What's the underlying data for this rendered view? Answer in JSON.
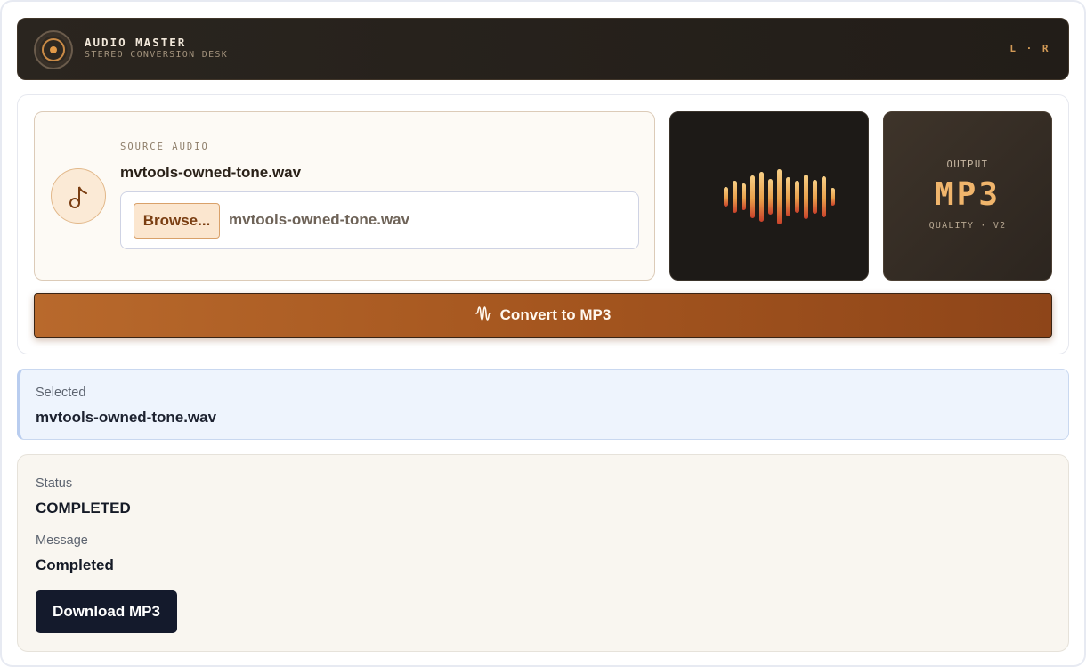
{
  "header": {
    "title": "AUDIO MASTER",
    "subtitle": "STEREO CONVERSION DESK",
    "channels": "L · R"
  },
  "source": {
    "label": "SOURCE AUDIO",
    "file_name": "mvtools-owned-tone.wav",
    "browse_label": "Browse...",
    "input_value": "mvtools-owned-tone.wav"
  },
  "output": {
    "label": "OUTPUT",
    "format": "MP3",
    "quality": "QUALITY · V2"
  },
  "convert_label": "Convert to MP3",
  "selected": {
    "label": "Selected",
    "value": "mvtools-owned-tone.wav"
  },
  "status": {
    "status_label": "Status",
    "status_value": "COMPLETED",
    "message_label": "Message",
    "message_value": "Completed",
    "download_label": "Download MP3"
  },
  "icons": {
    "logo": "vinyl-record-icon",
    "source": "music-note-icon",
    "waveform": "waveform-bars-icon",
    "convert": "sound-wave-icon"
  },
  "colors": {
    "accent": "#b8692c",
    "header_bg": "#2a251f",
    "output_text": "#f0b56c",
    "download_bg": "#141a2c",
    "selected_bg": "#eef4fd"
  }
}
